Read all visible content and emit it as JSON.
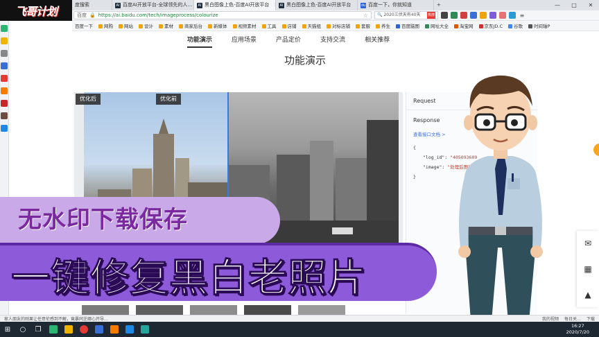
{
  "logo": {
    "text": "飞哥计划"
  },
  "tabs": [
    {
      "title": "度搜索",
      "active": false
    },
    {
      "title": "百度AI开放平台-全球领先的人…",
      "active": false
    },
    {
      "title": "黑白图像上色-百度AI开放平台",
      "active": true
    },
    {
      "title": "黑白图像上色-百度AI开放平台",
      "active": false
    },
    {
      "title": "百度一下，你就知道",
      "active": false
    }
  ],
  "address_bar": {
    "prefix": "百度",
    "url": "https://ai.baidu.com/tech/imageprocess/colourize",
    "search_text": "2020三伏天有40天",
    "search_badge": "热搜"
  },
  "bookmarks": [
    "百度一下",
    "网购",
    "网站",
    "设计",
    "素材",
    "商家后台",
    "新媒体",
    "视频素材",
    "工具",
    "店铺",
    "天猫组",
    "对标店铺",
    "套服",
    "养生",
    "百度脑图",
    "网址大全",
    "淘宝网",
    "京东JD.C",
    "谷歌",
    "时间轴P"
  ],
  "subnav": {
    "items": [
      "功能演示",
      "应用场景",
      "产品定价",
      "支持交流",
      "相关推荐"
    ],
    "active_index": 0
  },
  "section_title": "功能演示",
  "demo": {
    "label_after": "优化后",
    "label_before": "优化前"
  },
  "panel": {
    "request_label": "Request",
    "response_label": "Response",
    "doc_link": "查看接口文档 >",
    "brace_open": "{",
    "log_id_key": "\"log_id\":",
    "log_id_value": "\"405093609",
    "image_key": "\"image\":",
    "image_value": "\"处理后图片的",
    "brace_close": "}"
  },
  "captions": {
    "line1": "无水印下载保存",
    "line2": "一键修复黑白老照片"
  },
  "status_bar": {
    "left": "家人朋友的刚果让任意伦感到不解，竟暴同芝娜心开导…",
    "my_video": "我的视频",
    "daily": "每日关…",
    "download": "下载"
  },
  "clock": {
    "time": "16:27",
    "date": "2020/7/20"
  },
  "colors": {
    "caption_light": "#c9a9e8",
    "caption_dark": "#8d5bd9",
    "link": "#3a6fd8",
    "accent": "#3a7bd5"
  },
  "icons": [
    "back-icon",
    "forward-icon",
    "refresh-icon",
    "home-icon",
    "lock-icon",
    "star-icon",
    "search-icon",
    "mail-icon",
    "qr-icon",
    "up-arrow-icon",
    "windows-start-icon",
    "cortana-icon",
    "taskview-icon"
  ]
}
